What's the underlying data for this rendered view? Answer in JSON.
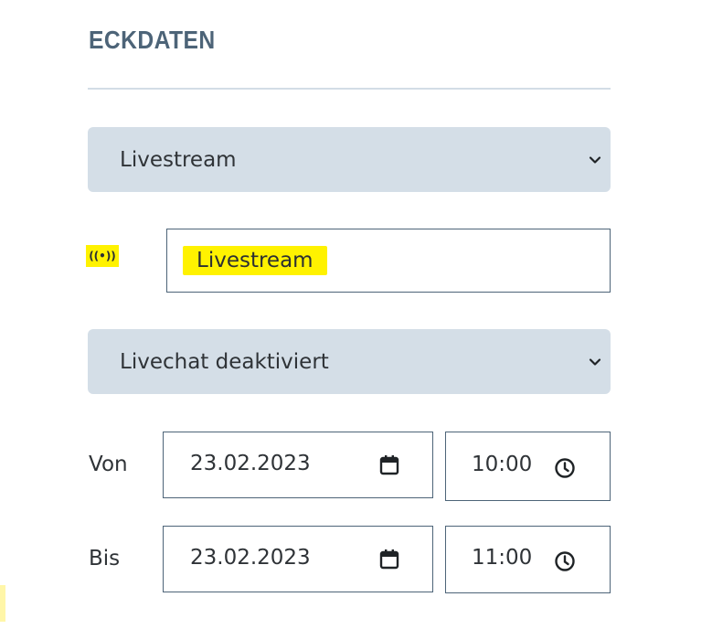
{
  "section": {
    "title": "ECKDATEN"
  },
  "type_select": {
    "value": "Livestream",
    "icon": "chevron-down-icon"
  },
  "stream": {
    "icon": "broadcast-icon",
    "icon_glyph": "((•))",
    "value": "Livestream"
  },
  "chat_select": {
    "value": "Livechat deaktiviert",
    "icon": "chevron-down-icon"
  },
  "von": {
    "label": "Von",
    "date": "23.02.2023",
    "time": "10:00"
  },
  "bis": {
    "label": "Bis",
    "date": "23.02.2023",
    "time": "11:00"
  },
  "colors": {
    "accent": "#4d6478",
    "select_bg": "#d4dee7",
    "highlight": "#fff200"
  }
}
